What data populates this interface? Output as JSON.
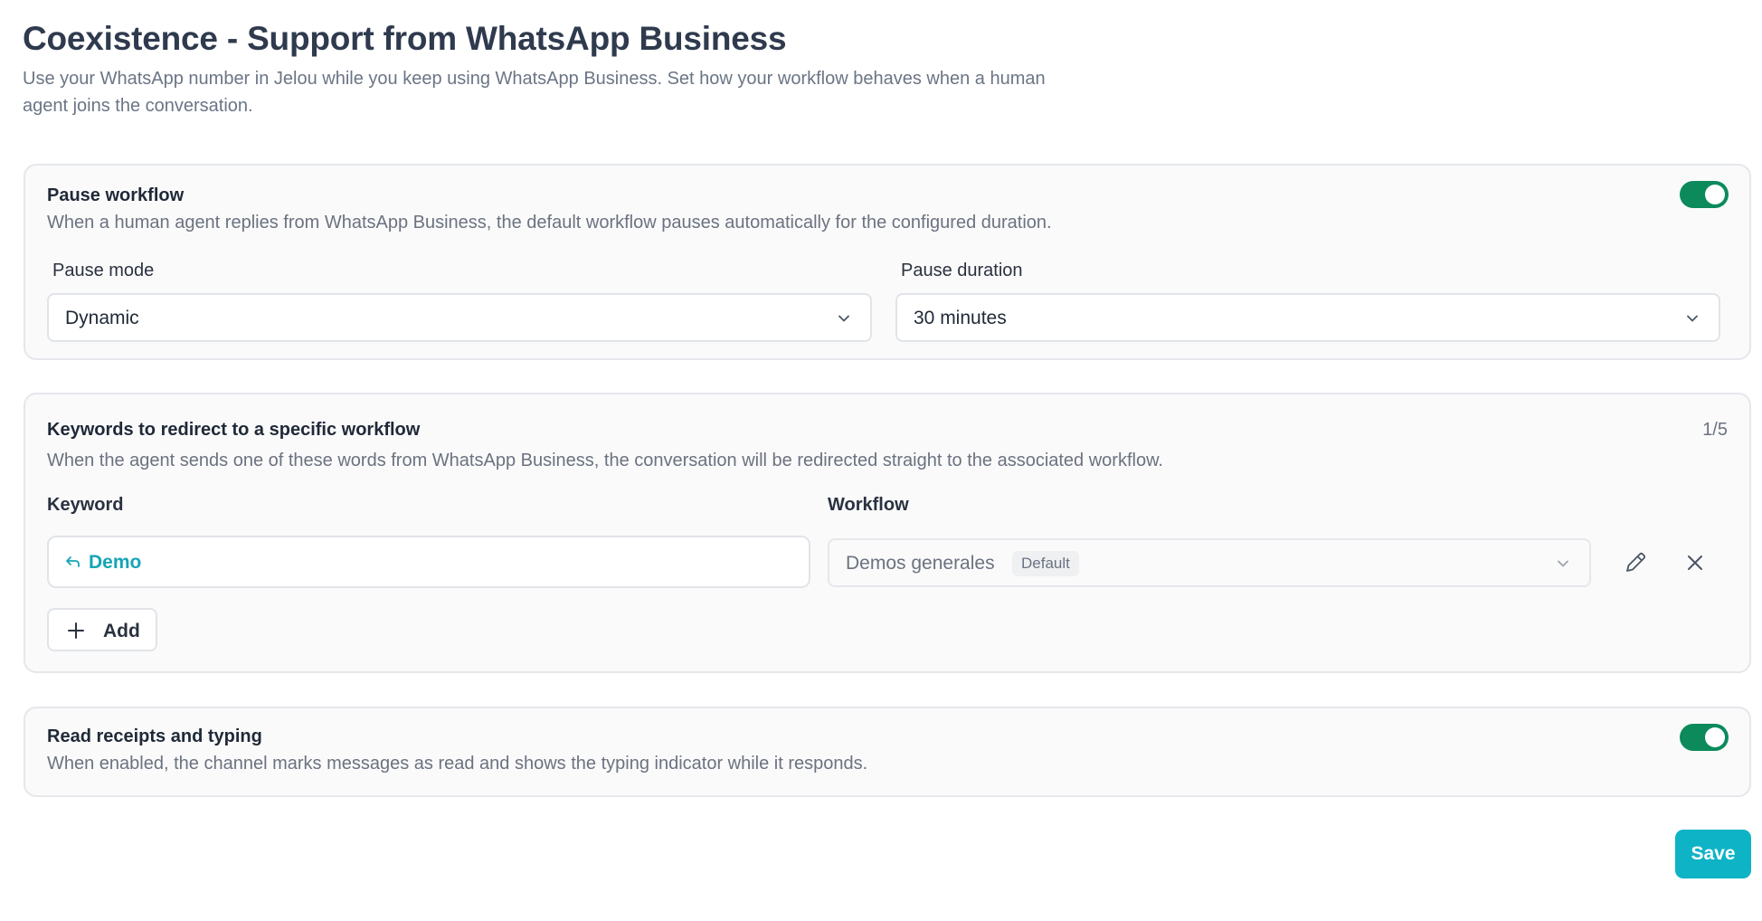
{
  "header": {
    "title": "Coexistence - Support from WhatsApp Business",
    "subtitle": "Use your WhatsApp number in Jelou while you keep using WhatsApp Business. Set how your workflow behaves when a human agent joins the conversation."
  },
  "pause_workflow": {
    "title": "Pause workflow",
    "description": "When a human agent replies from WhatsApp Business, the default workflow pauses automatically for the configured duration.",
    "enabled": true,
    "mode_label": "Pause mode",
    "mode_value": "Dynamic",
    "duration_label": "Pause duration",
    "duration_value": "30 minutes"
  },
  "keywords": {
    "title": "Keywords to redirect to a specific workflow",
    "counter": "1/5",
    "description": "When the agent sends one of these words from WhatsApp Business, the conversation will be redirected straight to the associated workflow.",
    "keyword_label": "Keyword",
    "workflow_label": "Workflow",
    "rows": [
      {
        "keyword": "Demo",
        "workflow": "Demos generales",
        "badge": "Default"
      }
    ],
    "add_label": "Add"
  },
  "read_receipts": {
    "title": "Read receipts and typing",
    "description": "When enabled, the channel marks messages as read and shows the typing indicator while it responds.",
    "enabled": true
  },
  "actions": {
    "save_label": "Save"
  },
  "colors": {
    "toggle_on": "#0c8a5c",
    "accent": "#0eb3c6",
    "keyword_text": "#16a5b5"
  },
  "icons": {
    "chevron": "chevron-down-icon",
    "keyword_arrow": "reply-arrow-icon",
    "edit": "pencil-icon",
    "remove": "close-icon",
    "add": "plus-icon"
  }
}
